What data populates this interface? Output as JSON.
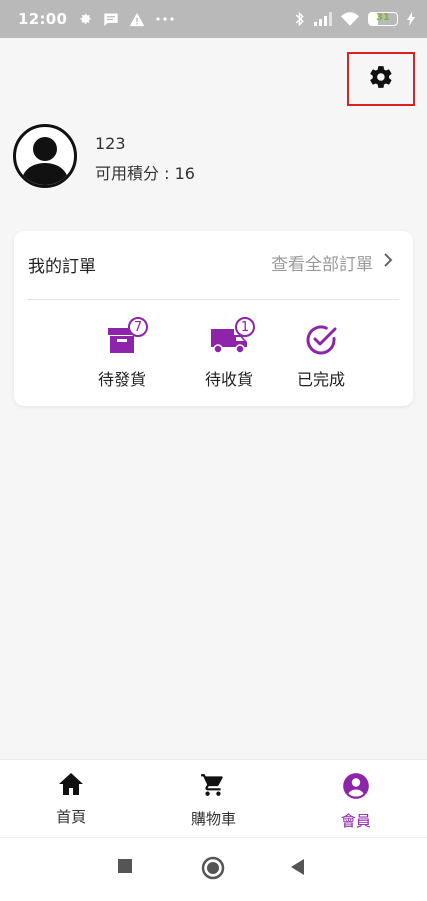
{
  "status_bar": {
    "time": "12:00",
    "left_icons": [
      "gear-alert-icon",
      "message-icon",
      "warning-icon",
      "more-icon"
    ],
    "right_icons": [
      "bluetooth-icon",
      "signal-icon",
      "wifi-icon"
    ],
    "battery_level": "31",
    "battery_fraction": 0.31
  },
  "header": {
    "settings_icon": "settings-icon"
  },
  "profile": {
    "username": "123",
    "points_text": "可用積分 : 16"
  },
  "orders": {
    "title": "我的訂單",
    "view_all": "查看全部訂單",
    "items": [
      {
        "label": "待發貨",
        "badge": "7",
        "icon": "box-icon"
      },
      {
        "label": "待收貨",
        "badge": "1",
        "icon": "truck-icon"
      },
      {
        "label": "已完成",
        "badge": "",
        "icon": "check-circle-icon"
      }
    ]
  },
  "bottom_nav": {
    "items": [
      {
        "label": "首頁",
        "icon": "home-icon"
      },
      {
        "label": "購物車",
        "icon": "cart-icon"
      },
      {
        "label": "會員",
        "icon": "account-icon",
        "active": true
      }
    ]
  },
  "system_nav": {
    "items": [
      "recents-square-icon",
      "home-circle-icon",
      "back-triangle-icon"
    ]
  },
  "colors": {
    "accent": "#8e24aa",
    "highlight_border": "#e02020",
    "status_bar_bg": "#b9b9b9"
  }
}
